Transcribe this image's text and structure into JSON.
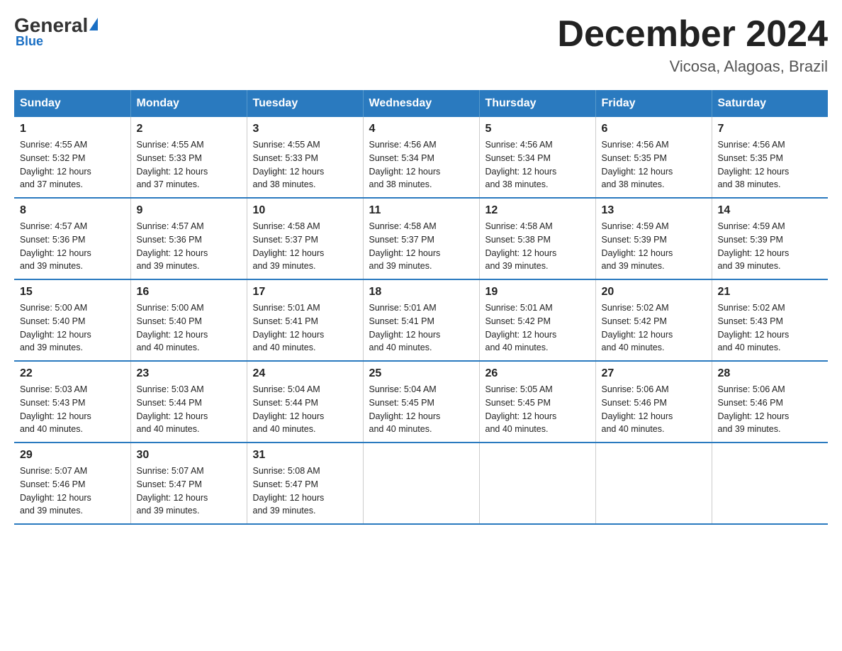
{
  "logo": {
    "general": "General",
    "blue": "Blue"
  },
  "title": "December 2024",
  "subtitle": "Vicosa, Alagoas, Brazil",
  "days_of_week": [
    "Sunday",
    "Monday",
    "Tuesday",
    "Wednesday",
    "Thursday",
    "Friday",
    "Saturday"
  ],
  "weeks": [
    [
      {
        "day": "1",
        "info": "Sunrise: 4:55 AM\nSunset: 5:32 PM\nDaylight: 12 hours\nand 37 minutes."
      },
      {
        "day": "2",
        "info": "Sunrise: 4:55 AM\nSunset: 5:33 PM\nDaylight: 12 hours\nand 37 minutes."
      },
      {
        "day": "3",
        "info": "Sunrise: 4:55 AM\nSunset: 5:33 PM\nDaylight: 12 hours\nand 38 minutes."
      },
      {
        "day": "4",
        "info": "Sunrise: 4:56 AM\nSunset: 5:34 PM\nDaylight: 12 hours\nand 38 minutes."
      },
      {
        "day": "5",
        "info": "Sunrise: 4:56 AM\nSunset: 5:34 PM\nDaylight: 12 hours\nand 38 minutes."
      },
      {
        "day": "6",
        "info": "Sunrise: 4:56 AM\nSunset: 5:35 PM\nDaylight: 12 hours\nand 38 minutes."
      },
      {
        "day": "7",
        "info": "Sunrise: 4:56 AM\nSunset: 5:35 PM\nDaylight: 12 hours\nand 38 minutes."
      }
    ],
    [
      {
        "day": "8",
        "info": "Sunrise: 4:57 AM\nSunset: 5:36 PM\nDaylight: 12 hours\nand 39 minutes."
      },
      {
        "day": "9",
        "info": "Sunrise: 4:57 AM\nSunset: 5:36 PM\nDaylight: 12 hours\nand 39 minutes."
      },
      {
        "day": "10",
        "info": "Sunrise: 4:58 AM\nSunset: 5:37 PM\nDaylight: 12 hours\nand 39 minutes."
      },
      {
        "day": "11",
        "info": "Sunrise: 4:58 AM\nSunset: 5:37 PM\nDaylight: 12 hours\nand 39 minutes."
      },
      {
        "day": "12",
        "info": "Sunrise: 4:58 AM\nSunset: 5:38 PM\nDaylight: 12 hours\nand 39 minutes."
      },
      {
        "day": "13",
        "info": "Sunrise: 4:59 AM\nSunset: 5:39 PM\nDaylight: 12 hours\nand 39 minutes."
      },
      {
        "day": "14",
        "info": "Sunrise: 4:59 AM\nSunset: 5:39 PM\nDaylight: 12 hours\nand 39 minutes."
      }
    ],
    [
      {
        "day": "15",
        "info": "Sunrise: 5:00 AM\nSunset: 5:40 PM\nDaylight: 12 hours\nand 39 minutes."
      },
      {
        "day": "16",
        "info": "Sunrise: 5:00 AM\nSunset: 5:40 PM\nDaylight: 12 hours\nand 40 minutes."
      },
      {
        "day": "17",
        "info": "Sunrise: 5:01 AM\nSunset: 5:41 PM\nDaylight: 12 hours\nand 40 minutes."
      },
      {
        "day": "18",
        "info": "Sunrise: 5:01 AM\nSunset: 5:41 PM\nDaylight: 12 hours\nand 40 minutes."
      },
      {
        "day": "19",
        "info": "Sunrise: 5:01 AM\nSunset: 5:42 PM\nDaylight: 12 hours\nand 40 minutes."
      },
      {
        "day": "20",
        "info": "Sunrise: 5:02 AM\nSunset: 5:42 PM\nDaylight: 12 hours\nand 40 minutes."
      },
      {
        "day": "21",
        "info": "Sunrise: 5:02 AM\nSunset: 5:43 PM\nDaylight: 12 hours\nand 40 minutes."
      }
    ],
    [
      {
        "day": "22",
        "info": "Sunrise: 5:03 AM\nSunset: 5:43 PM\nDaylight: 12 hours\nand 40 minutes."
      },
      {
        "day": "23",
        "info": "Sunrise: 5:03 AM\nSunset: 5:44 PM\nDaylight: 12 hours\nand 40 minutes."
      },
      {
        "day": "24",
        "info": "Sunrise: 5:04 AM\nSunset: 5:44 PM\nDaylight: 12 hours\nand 40 minutes."
      },
      {
        "day": "25",
        "info": "Sunrise: 5:04 AM\nSunset: 5:45 PM\nDaylight: 12 hours\nand 40 minutes."
      },
      {
        "day": "26",
        "info": "Sunrise: 5:05 AM\nSunset: 5:45 PM\nDaylight: 12 hours\nand 40 minutes."
      },
      {
        "day": "27",
        "info": "Sunrise: 5:06 AM\nSunset: 5:46 PM\nDaylight: 12 hours\nand 40 minutes."
      },
      {
        "day": "28",
        "info": "Sunrise: 5:06 AM\nSunset: 5:46 PM\nDaylight: 12 hours\nand 39 minutes."
      }
    ],
    [
      {
        "day": "29",
        "info": "Sunrise: 5:07 AM\nSunset: 5:46 PM\nDaylight: 12 hours\nand 39 minutes."
      },
      {
        "day": "30",
        "info": "Sunrise: 5:07 AM\nSunset: 5:47 PM\nDaylight: 12 hours\nand 39 minutes."
      },
      {
        "day": "31",
        "info": "Sunrise: 5:08 AM\nSunset: 5:47 PM\nDaylight: 12 hours\nand 39 minutes."
      },
      {
        "day": "",
        "info": ""
      },
      {
        "day": "",
        "info": ""
      },
      {
        "day": "",
        "info": ""
      },
      {
        "day": "",
        "info": ""
      }
    ]
  ]
}
